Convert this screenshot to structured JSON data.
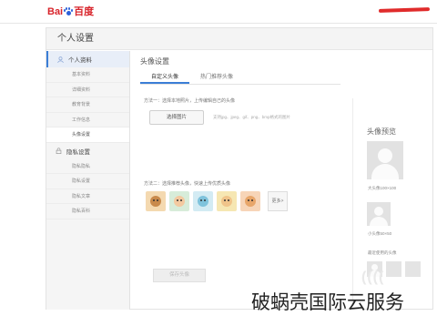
{
  "header": {
    "logo_left": "Bai",
    "logo_right": "百度"
  },
  "page": {
    "title": "个人设置"
  },
  "sidebar": {
    "groups": [
      {
        "title": "个人资料",
        "icon": "user-icon",
        "items": [
          "基本资料",
          "详细资料",
          "教育背景",
          "工作信息",
          "头像设置"
        ]
      },
      {
        "title": "隐私设置",
        "icon": "lock-icon",
        "items": [
          "隐私隐私",
          "隐私设置",
          "隐私文章",
          "隐私百科"
        ]
      }
    ]
  },
  "main": {
    "section_title": "头像设置",
    "tabs": [
      "自定义头像",
      "热门推荐头像"
    ],
    "method1": "方法一：选择本地照片，上传编辑自己的头像",
    "upload_button": "选择图片",
    "upload_hint": "支持jpg、jpeg、gif、png、bmp格式的图片",
    "method2": "方法二：选择推荐头像，快速上传优质头像",
    "presets": [
      {
        "name": "cartoon-bear",
        "bg": "#f4d9b0",
        "face": "#c98a4b"
      },
      {
        "name": "cartoon-boy",
        "bg": "#d7ecd9",
        "face": "#f3c9a0"
      },
      {
        "name": "cartoon-cat",
        "bg": "#d3ebf3",
        "face": "#7fc3dc"
      },
      {
        "name": "cartoon-girl",
        "bg": "#f6e7b3",
        "face": "#f0c48a"
      },
      {
        "name": "cartoon-dog",
        "bg": "#f7d5b8",
        "face": "#e8a66a"
      }
    ],
    "more_button": "更多>",
    "save_button": "保存头像"
  },
  "preview": {
    "title": "头像预览",
    "large_caption": "大头像100×100",
    "small_caption": "小头像50×50",
    "recent_label": "最近使用的头像",
    "recent_count": 3
  },
  "watermark": {
    "faint": "((((",
    "text": "破蜗壳国际云服务"
  },
  "colors": {
    "accent": "#3b7ed6",
    "brand_red": "#d8232a",
    "brand_blue": "#2b5fd9"
  }
}
